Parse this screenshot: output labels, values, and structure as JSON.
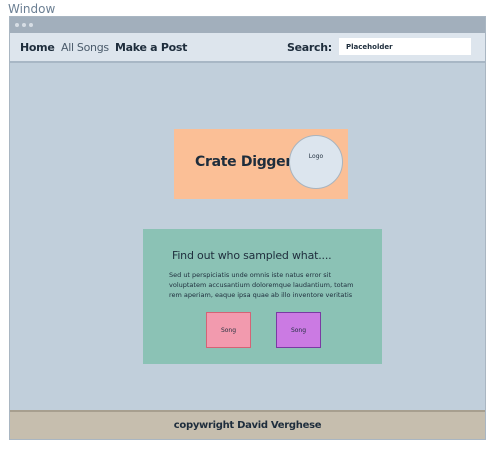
{
  "window": {
    "caption": "Window"
  },
  "nav": {
    "home": "Home",
    "all_songs": "All Songs",
    "make_post": "Make a Post",
    "search_label": "Search:",
    "search_placeholder": "Placeholder"
  },
  "hero": {
    "title": "Crate Digger",
    "logo_label": "Logo"
  },
  "info": {
    "heading": "Find out who sampled what....",
    "body": "Sed ut perspiciatis unde omnis iste natus error sit voluptatem accusantium doloremque laudantium, totam rem aperiam, eaque ipsa quae ab illo inventore veritatis",
    "song1": "Song",
    "song2": "Song"
  },
  "footer": {
    "text": "copywright David Verghese"
  },
  "colors": {
    "page_bg": "#c1cfdb",
    "hero_bg": "#fbbf96",
    "card_bg": "#8bc2b5",
    "song_pink": "#f29aae",
    "song_purple": "#cb7ae3",
    "footer_bg": "#c6beae"
  }
}
